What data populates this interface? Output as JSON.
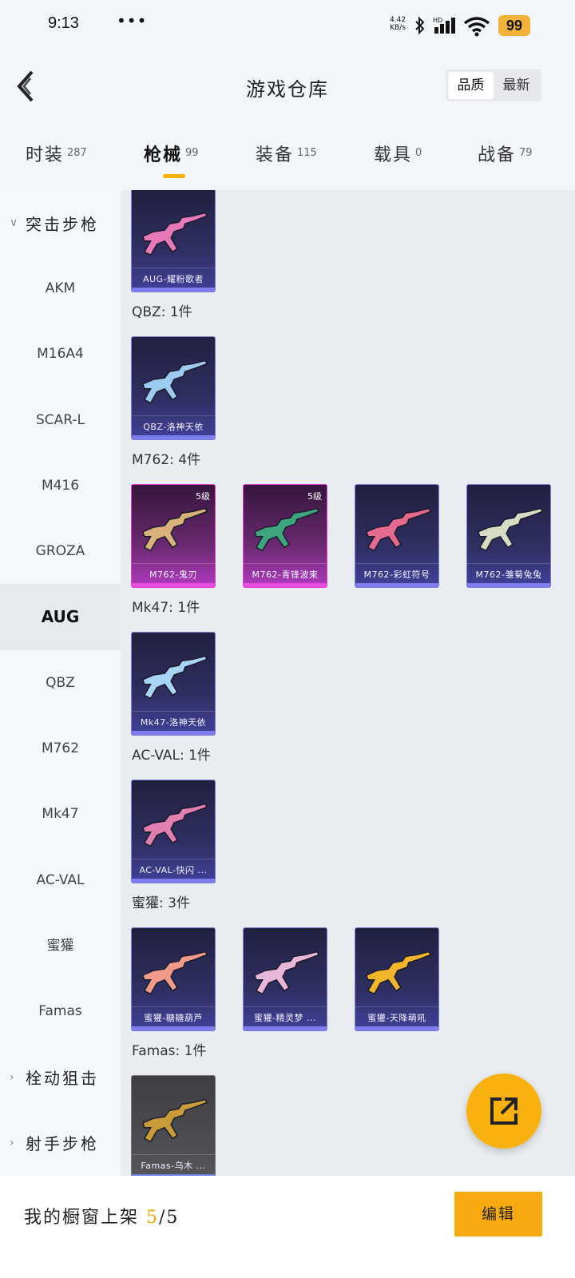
{
  "status_bar": {
    "time": "9:13",
    "more": "•••",
    "net_speed": "4.42",
    "net_unit": "KB/s",
    "battery": "99",
    "icons": [
      "bluetooth-icon",
      "signal-icon",
      "wifi-icon",
      "battery-icon"
    ]
  },
  "header": {
    "title": "游戏仓库",
    "sort": [
      "品质",
      "最新"
    ],
    "sort_active": "品质"
  },
  "tabs": [
    {
      "label": "时装",
      "count": "287"
    },
    {
      "label": "枪械",
      "count": "99",
      "active": true
    },
    {
      "label": "装备",
      "count": "115"
    },
    {
      "label": "载具",
      "count": "0"
    },
    {
      "label": "战备",
      "count": "79"
    }
  ],
  "sidebar": {
    "group_assault": "突击步枪",
    "items": [
      "AKM",
      "M16A4",
      "SCAR-L",
      "M416",
      "GROZA",
      "AUG",
      "QBZ",
      "M762",
      "Mk47",
      "AC-VAL",
      "蜜獾",
      "Famas"
    ],
    "active_item": "AUG",
    "group_bolt": "栓动狙击",
    "group_marksman": "射手步枪"
  },
  "sections": [
    {
      "title": "",
      "cards": [
        {
          "name": "AUG-耀粉歌者",
          "level": "",
          "color": "#e879b8"
        }
      ]
    },
    {
      "title": "QBZ: 1件",
      "cards": [
        {
          "name": "QBZ-洛神天依",
          "level": "",
          "color": "#9ecbf0"
        }
      ]
    },
    {
      "title": "M762: 4件",
      "cards": [
        {
          "name": "M762-鬼刃",
          "level": "5级",
          "color": "#d8b27a"
        },
        {
          "name": "M762-青锋波束",
          "level": "5级",
          "color": "#3ea57f"
        },
        {
          "name": "M762-彩虹符号",
          "level": "",
          "color": "#e46a8f"
        },
        {
          "name": "M762-雏菊兔兔",
          "level": "",
          "color": "#d8dcc4"
        }
      ]
    },
    {
      "title": "Mk47: 1件",
      "cards": [
        {
          "name": "Mk47-洛神天依",
          "level": "",
          "color": "#a8d4f5"
        }
      ]
    },
    {
      "title": "AC-VAL: 1件",
      "cards": [
        {
          "name": "AC-VAL-快闪 ...",
          "level": "",
          "color": "#e07fb0"
        }
      ]
    },
    {
      "title": "蜜獾: 3件",
      "cards": [
        {
          "name": "蜜獾-糖糖葫芦",
          "level": "",
          "color": "#f09a8a"
        },
        {
          "name": "蜜獾-精灵梦 ...",
          "level": "",
          "color": "#e6b7d8"
        },
        {
          "name": "蜜獾-天降萌吼",
          "level": "",
          "color": "#f0b52a"
        }
      ]
    },
    {
      "title": "Famas: 1件",
      "cards": [
        {
          "name": "Famas-乌木 ...",
          "level": "",
          "color": "#c79a3a"
        }
      ]
    }
  ],
  "bottom": {
    "shelf_label": "我的橱窗上架",
    "shelf_current": "5",
    "shelf_total": "/5",
    "edit_label": "编辑"
  },
  "colors": {
    "accent": "#f8a90f",
    "epic_border": "#7d7dd8",
    "legend_border": "#e23fd0"
  }
}
